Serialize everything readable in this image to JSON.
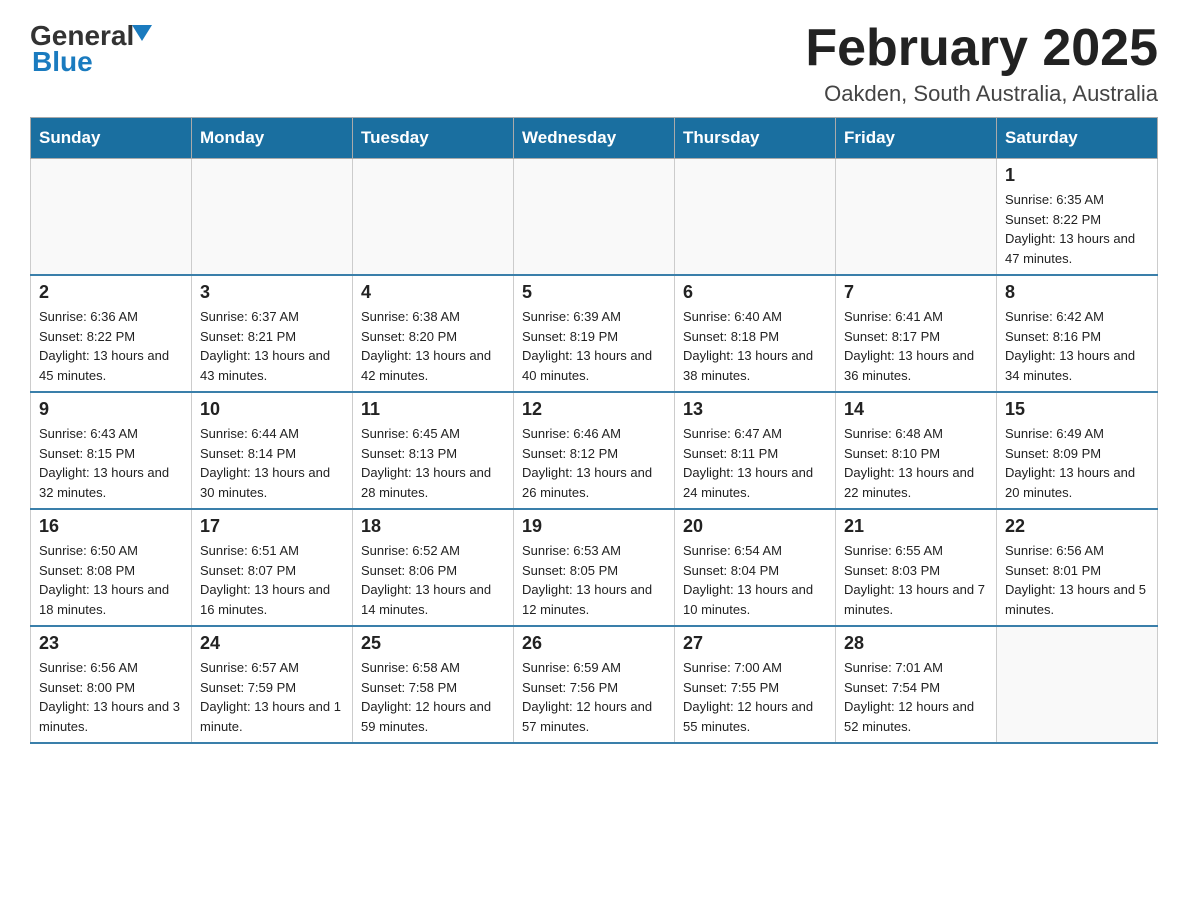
{
  "header": {
    "logo_general": "General",
    "logo_blue": "Blue",
    "month_title": "February 2025",
    "location": "Oakden, South Australia, Australia"
  },
  "days_of_week": [
    "Sunday",
    "Monday",
    "Tuesday",
    "Wednesday",
    "Thursday",
    "Friday",
    "Saturday"
  ],
  "weeks": [
    [
      {
        "day": "",
        "info": ""
      },
      {
        "day": "",
        "info": ""
      },
      {
        "day": "",
        "info": ""
      },
      {
        "day": "",
        "info": ""
      },
      {
        "day": "",
        "info": ""
      },
      {
        "day": "",
        "info": ""
      },
      {
        "day": "1",
        "info": "Sunrise: 6:35 AM\nSunset: 8:22 PM\nDaylight: 13 hours and 47 minutes."
      }
    ],
    [
      {
        "day": "2",
        "info": "Sunrise: 6:36 AM\nSunset: 8:22 PM\nDaylight: 13 hours and 45 minutes."
      },
      {
        "day": "3",
        "info": "Sunrise: 6:37 AM\nSunset: 8:21 PM\nDaylight: 13 hours and 43 minutes."
      },
      {
        "day": "4",
        "info": "Sunrise: 6:38 AM\nSunset: 8:20 PM\nDaylight: 13 hours and 42 minutes."
      },
      {
        "day": "5",
        "info": "Sunrise: 6:39 AM\nSunset: 8:19 PM\nDaylight: 13 hours and 40 minutes."
      },
      {
        "day": "6",
        "info": "Sunrise: 6:40 AM\nSunset: 8:18 PM\nDaylight: 13 hours and 38 minutes."
      },
      {
        "day": "7",
        "info": "Sunrise: 6:41 AM\nSunset: 8:17 PM\nDaylight: 13 hours and 36 minutes."
      },
      {
        "day": "8",
        "info": "Sunrise: 6:42 AM\nSunset: 8:16 PM\nDaylight: 13 hours and 34 minutes."
      }
    ],
    [
      {
        "day": "9",
        "info": "Sunrise: 6:43 AM\nSunset: 8:15 PM\nDaylight: 13 hours and 32 minutes."
      },
      {
        "day": "10",
        "info": "Sunrise: 6:44 AM\nSunset: 8:14 PM\nDaylight: 13 hours and 30 minutes."
      },
      {
        "day": "11",
        "info": "Sunrise: 6:45 AM\nSunset: 8:13 PM\nDaylight: 13 hours and 28 minutes."
      },
      {
        "day": "12",
        "info": "Sunrise: 6:46 AM\nSunset: 8:12 PM\nDaylight: 13 hours and 26 minutes."
      },
      {
        "day": "13",
        "info": "Sunrise: 6:47 AM\nSunset: 8:11 PM\nDaylight: 13 hours and 24 minutes."
      },
      {
        "day": "14",
        "info": "Sunrise: 6:48 AM\nSunset: 8:10 PM\nDaylight: 13 hours and 22 minutes."
      },
      {
        "day": "15",
        "info": "Sunrise: 6:49 AM\nSunset: 8:09 PM\nDaylight: 13 hours and 20 minutes."
      }
    ],
    [
      {
        "day": "16",
        "info": "Sunrise: 6:50 AM\nSunset: 8:08 PM\nDaylight: 13 hours and 18 minutes."
      },
      {
        "day": "17",
        "info": "Sunrise: 6:51 AM\nSunset: 8:07 PM\nDaylight: 13 hours and 16 minutes."
      },
      {
        "day": "18",
        "info": "Sunrise: 6:52 AM\nSunset: 8:06 PM\nDaylight: 13 hours and 14 minutes."
      },
      {
        "day": "19",
        "info": "Sunrise: 6:53 AM\nSunset: 8:05 PM\nDaylight: 13 hours and 12 minutes."
      },
      {
        "day": "20",
        "info": "Sunrise: 6:54 AM\nSunset: 8:04 PM\nDaylight: 13 hours and 10 minutes."
      },
      {
        "day": "21",
        "info": "Sunrise: 6:55 AM\nSunset: 8:03 PM\nDaylight: 13 hours and 7 minutes."
      },
      {
        "day": "22",
        "info": "Sunrise: 6:56 AM\nSunset: 8:01 PM\nDaylight: 13 hours and 5 minutes."
      }
    ],
    [
      {
        "day": "23",
        "info": "Sunrise: 6:56 AM\nSunset: 8:00 PM\nDaylight: 13 hours and 3 minutes."
      },
      {
        "day": "24",
        "info": "Sunrise: 6:57 AM\nSunset: 7:59 PM\nDaylight: 13 hours and 1 minute."
      },
      {
        "day": "25",
        "info": "Sunrise: 6:58 AM\nSunset: 7:58 PM\nDaylight: 12 hours and 59 minutes."
      },
      {
        "day": "26",
        "info": "Sunrise: 6:59 AM\nSunset: 7:56 PM\nDaylight: 12 hours and 57 minutes."
      },
      {
        "day": "27",
        "info": "Sunrise: 7:00 AM\nSunset: 7:55 PM\nDaylight: 12 hours and 55 minutes."
      },
      {
        "day": "28",
        "info": "Sunrise: 7:01 AM\nSunset: 7:54 PM\nDaylight: 12 hours and 52 minutes."
      },
      {
        "day": "",
        "info": ""
      }
    ]
  ]
}
